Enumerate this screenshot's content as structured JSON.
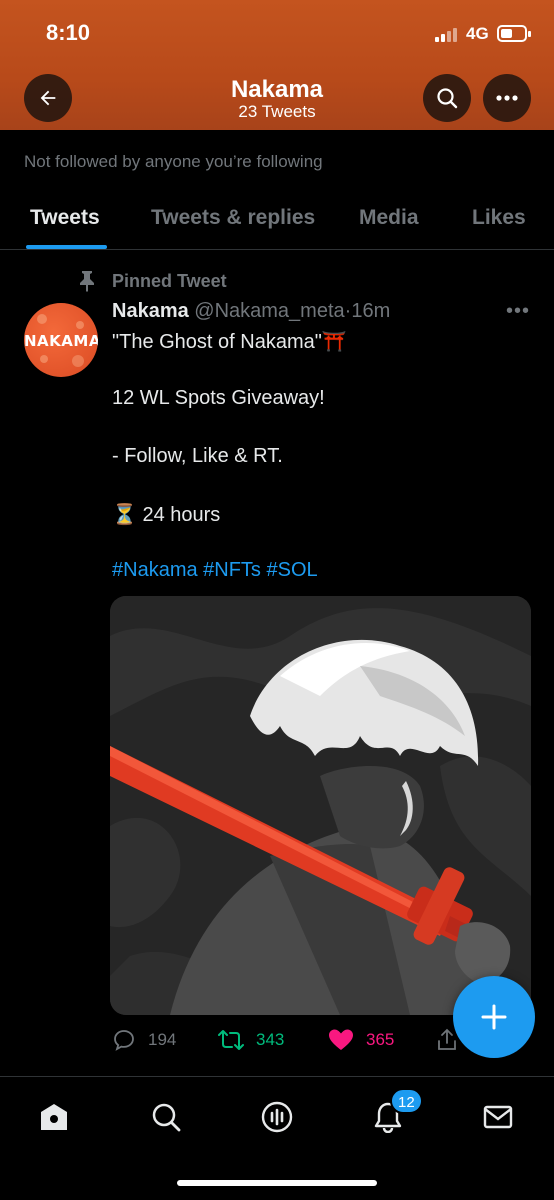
{
  "status_bar": {
    "time": "8:10",
    "network": "4G"
  },
  "header": {
    "title": "Nakama",
    "subtitle": "23 Tweets"
  },
  "profile": {
    "follow_note": "Not followed by anyone you’re following"
  },
  "tabs": [
    {
      "label": "Tweets",
      "active": true
    },
    {
      "label": "Tweets & replies",
      "active": false
    },
    {
      "label": "Media",
      "active": false
    },
    {
      "label": "Likes",
      "active": false
    }
  ],
  "tweet": {
    "pinned_label": "Pinned Tweet",
    "avatar_text": "NAKAMA",
    "name": "Nakama",
    "handle": "@Nakama_meta",
    "separator": "·",
    "time": "16m",
    "more": "•••",
    "lines": [
      "\"The Ghost of Nakama\"⛩️",
      "12 WL Spots Giveaway!",
      "- Follow, Like & RT.",
      "⏳ 24 hours"
    ],
    "hashtags": "#Nakama #NFTs #SOL",
    "stats": {
      "replies": "194",
      "retweets": "343",
      "likes": "365"
    }
  },
  "bottom_nav": {
    "notifications_badge": "12"
  },
  "colors": {
    "accent": "#1d9bf0",
    "header": "#b84a1a",
    "retweet": "#00ba7c",
    "like": "#f91880"
  }
}
